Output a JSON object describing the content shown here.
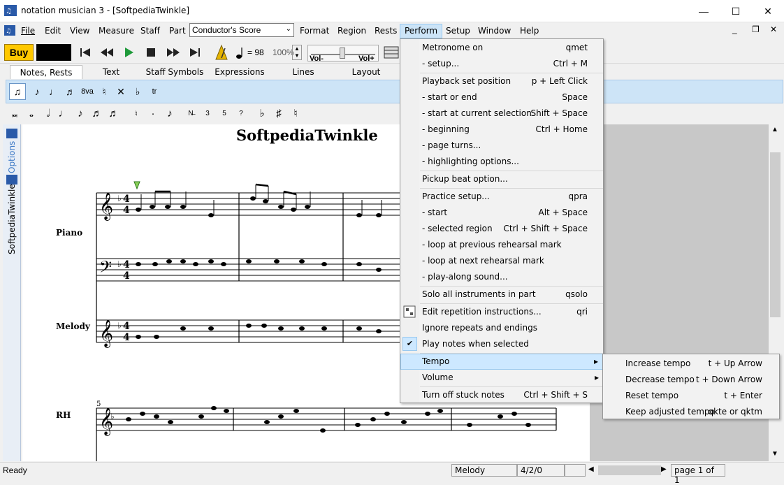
{
  "window": {
    "title": "notation musician 3 - [SoftpediaTwinkle]",
    "minimize_glyph": "—",
    "maximize_glyph": "☐",
    "close_glyph": "✕",
    "mdi_minimize_glyph": "_",
    "mdi_restore_glyph": "❐",
    "mdi_close_glyph": "✕"
  },
  "menubar": {
    "file": "File",
    "edit": "Edit",
    "view": "View",
    "measure": "Measure",
    "staff": "Staff",
    "part": "Part",
    "part_select_value": "Conductor's Score",
    "format": "Format",
    "region": "Region",
    "rests": "Rests",
    "perform": "Perform",
    "setup": "Setup",
    "window": "Window",
    "help": "Help"
  },
  "toolbar": {
    "buy_label": "Buy",
    "tempo_equals": "= 98",
    "zoom_value": "100%",
    "vol_minus_label": "Vol-",
    "vol_plus_label": "Vol+",
    "volume_level_fraction": 0.5
  },
  "tabs": [
    {
      "label": "Notes, Rests",
      "active": true
    },
    {
      "label": "Text"
    },
    {
      "label": "Staff Symbols"
    },
    {
      "label": "Expressions"
    },
    {
      "label": "Lines"
    },
    {
      "label": "Layout"
    }
  ],
  "side_panel": {
    "options_label": "Options",
    "document_label": "SoftpediaTwinkle"
  },
  "score": {
    "title": "SoftpediaTwinkle",
    "staff_labels": {
      "piano": "Piano",
      "melody": "Melody",
      "rh": "RH"
    },
    "measure_number": "5"
  },
  "perform_menu": {
    "items": [
      {
        "label": "Metronome on",
        "shortcut": "qmet"
      },
      {
        "label": "-      setup...",
        "shortcut": "Ctrl + M"
      },
      {
        "label": "Playback set position",
        "shortcut": "p + Left Click"
      },
      {
        "label": "-      start or end",
        "shortcut": "Space"
      },
      {
        "label": "-      start at current selection",
        "shortcut": "Shift + Space"
      },
      {
        "label": "-      beginning",
        "shortcut": "Ctrl + Home"
      },
      {
        "label": "-      page turns...",
        "shortcut": ""
      },
      {
        "label": "-      highlighting options...",
        "shortcut": ""
      },
      {
        "label": "Pickup beat option...",
        "shortcut": ""
      },
      {
        "label": "Practice setup...",
        "shortcut": "qpra"
      },
      {
        "label": "-      start",
        "shortcut": "Alt + Space"
      },
      {
        "label": "-      selected region",
        "shortcut": "Ctrl + Shift + Space"
      },
      {
        "label": "-      loop at previous rehearsal mark",
        "shortcut": ""
      },
      {
        "label": "-      loop at next rehearsal mark",
        "shortcut": ""
      },
      {
        "label": "-      play-along sound...",
        "shortcut": ""
      },
      {
        "label": "Solo all instruments in part",
        "shortcut": "qsolo"
      },
      {
        "label": "Edit repetition instructions...",
        "shortcut": "qri"
      },
      {
        "label": "Ignore repeats and endings",
        "shortcut": ""
      },
      {
        "label": "Play notes when selected",
        "shortcut": ""
      },
      {
        "label": "Tempo",
        "shortcut": "▸"
      },
      {
        "label": "Volume",
        "shortcut": "▸"
      },
      {
        "label": "Turn off stuck notes",
        "shortcut": "Ctrl + Shift + S"
      }
    ],
    "check_glyph": "✔"
  },
  "tempo_submenu": {
    "items": [
      {
        "label": "Increase tempo",
        "shortcut": "t + Up Arrow"
      },
      {
        "label": "Decrease tempo",
        "shortcut": "t + Down Arrow"
      },
      {
        "label": "Reset tempo",
        "shortcut": "t + Enter"
      },
      {
        "label": "Keep adjusted tempo",
        "shortcut": "qkte or qktm"
      }
    ]
  },
  "statusbar": {
    "status": "Ready",
    "part": "Melody",
    "position": "4/2/0",
    "page": "page 1 of 1"
  },
  "colors": {
    "buy": "#ffc800",
    "menu_highlight": "#cde8ff",
    "toolbar_blue": "#cde4f7"
  }
}
